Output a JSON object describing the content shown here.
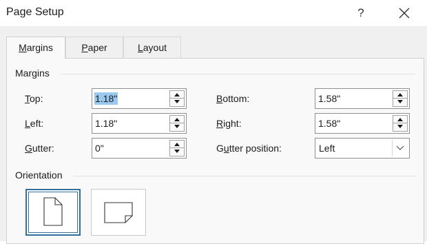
{
  "dialog": {
    "title": "Page Setup",
    "help_label": "?"
  },
  "tabs": [
    {
      "label": "Margins",
      "mnemonic": "M",
      "rest": "argins",
      "active": true
    },
    {
      "label": "Paper",
      "mnemonic": "P",
      "rest": "aper",
      "active": false
    },
    {
      "label": "Layout",
      "mnemonic": "L",
      "rest": "ayout",
      "active": false
    }
  ],
  "margins": {
    "section_label": "Margins",
    "top": {
      "mnemonic": "T",
      "rest": "op:",
      "value": "1.18\"",
      "selected": true
    },
    "bottom": {
      "mnemonic": "B",
      "rest": "ottom:",
      "value": "1.58\""
    },
    "left": {
      "mnemonic": "L",
      "rest": "eft:",
      "value": "1.18\""
    },
    "right": {
      "mnemonic": "R",
      "rest": "ight:",
      "value": "1.58\""
    },
    "gutter": {
      "mnemonic": "G",
      "rest": "utter:",
      "value": "0\""
    },
    "gutter_position": {
      "mnemonic": "u",
      "pre": "G",
      "rest": "tter position:",
      "value": "Left"
    }
  },
  "orientation": {
    "section_label": "Orientation",
    "options": [
      "portrait",
      "landscape"
    ],
    "selected": "portrait"
  },
  "colors": {
    "selection_highlight": "#99c9ef",
    "focus_border": "#2f6f9f"
  }
}
